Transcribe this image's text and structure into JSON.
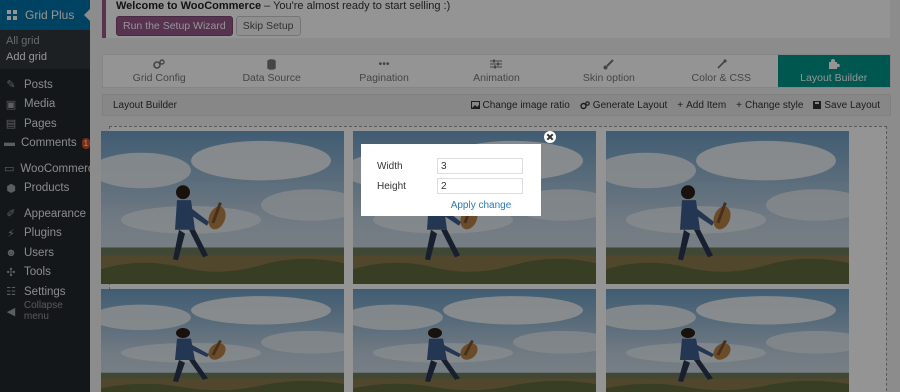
{
  "sidebar": {
    "active_item": "Grid Plus",
    "submenu": [
      "All grid",
      "Add grid"
    ],
    "items": [
      {
        "label": "Posts",
        "icon": "pushpin-icon"
      },
      {
        "label": "Media",
        "icon": "media-icon"
      },
      {
        "label": "Pages",
        "icon": "pages-icon"
      },
      {
        "label": "Comments",
        "icon": "comment-icon",
        "badge": "1"
      },
      {
        "label": "WooCommerce",
        "icon": "woocommerce-icon"
      },
      {
        "label": "Products",
        "icon": "products-icon"
      },
      {
        "label": "Appearance",
        "icon": "brush-icon"
      },
      {
        "label": "Plugins",
        "icon": "plug-icon"
      },
      {
        "label": "Users",
        "icon": "users-icon"
      },
      {
        "label": "Tools",
        "icon": "wrench-icon"
      },
      {
        "label": "Settings",
        "icon": "settings-icon"
      },
      {
        "label": "Collapse menu",
        "icon": "collapse-icon"
      }
    ]
  },
  "notice": {
    "strong": "Welcome to WooCommerce",
    "rest": " – You're almost ready to start selling :)",
    "primary_button": "Run the Setup Wizard",
    "secondary_button": "Skip Setup"
  },
  "tabs": [
    {
      "label": "Grid Config",
      "icon": "gears-icon"
    },
    {
      "label": "Data Source",
      "icon": "database-icon"
    },
    {
      "label": "Pagination",
      "icon": "ellipsis-icon"
    },
    {
      "label": "Animation",
      "icon": "sliders-icon"
    },
    {
      "label": "Skin option",
      "icon": "brush-icon"
    },
    {
      "label": "Color & CSS",
      "icon": "eyedropper-icon"
    },
    {
      "label": "Layout Builder",
      "icon": "puzzle-icon"
    }
  ],
  "active_tab": "Layout Builder",
  "toolbar": {
    "title": "Layout Builder",
    "tools": [
      {
        "label": "Change image ratio",
        "icon": "image-icon"
      },
      {
        "label": "Generate Layout",
        "icon": "gears-icon"
      },
      {
        "label": "Add Item",
        "icon": "plus-icon"
      },
      {
        "label": "Change style",
        "icon": "plus-icon"
      },
      {
        "label": "Save Layout",
        "icon": "save-icon"
      }
    ]
  },
  "modal": {
    "width_label": "Width",
    "width_value": "3",
    "height_label": "Height",
    "height_value": "2",
    "apply_label": "Apply change"
  },
  "colors": {
    "accent": "#009688",
    "wp_blue": "#0073aa",
    "sidebar": "#23282d",
    "woo_purple": "#96588a"
  }
}
